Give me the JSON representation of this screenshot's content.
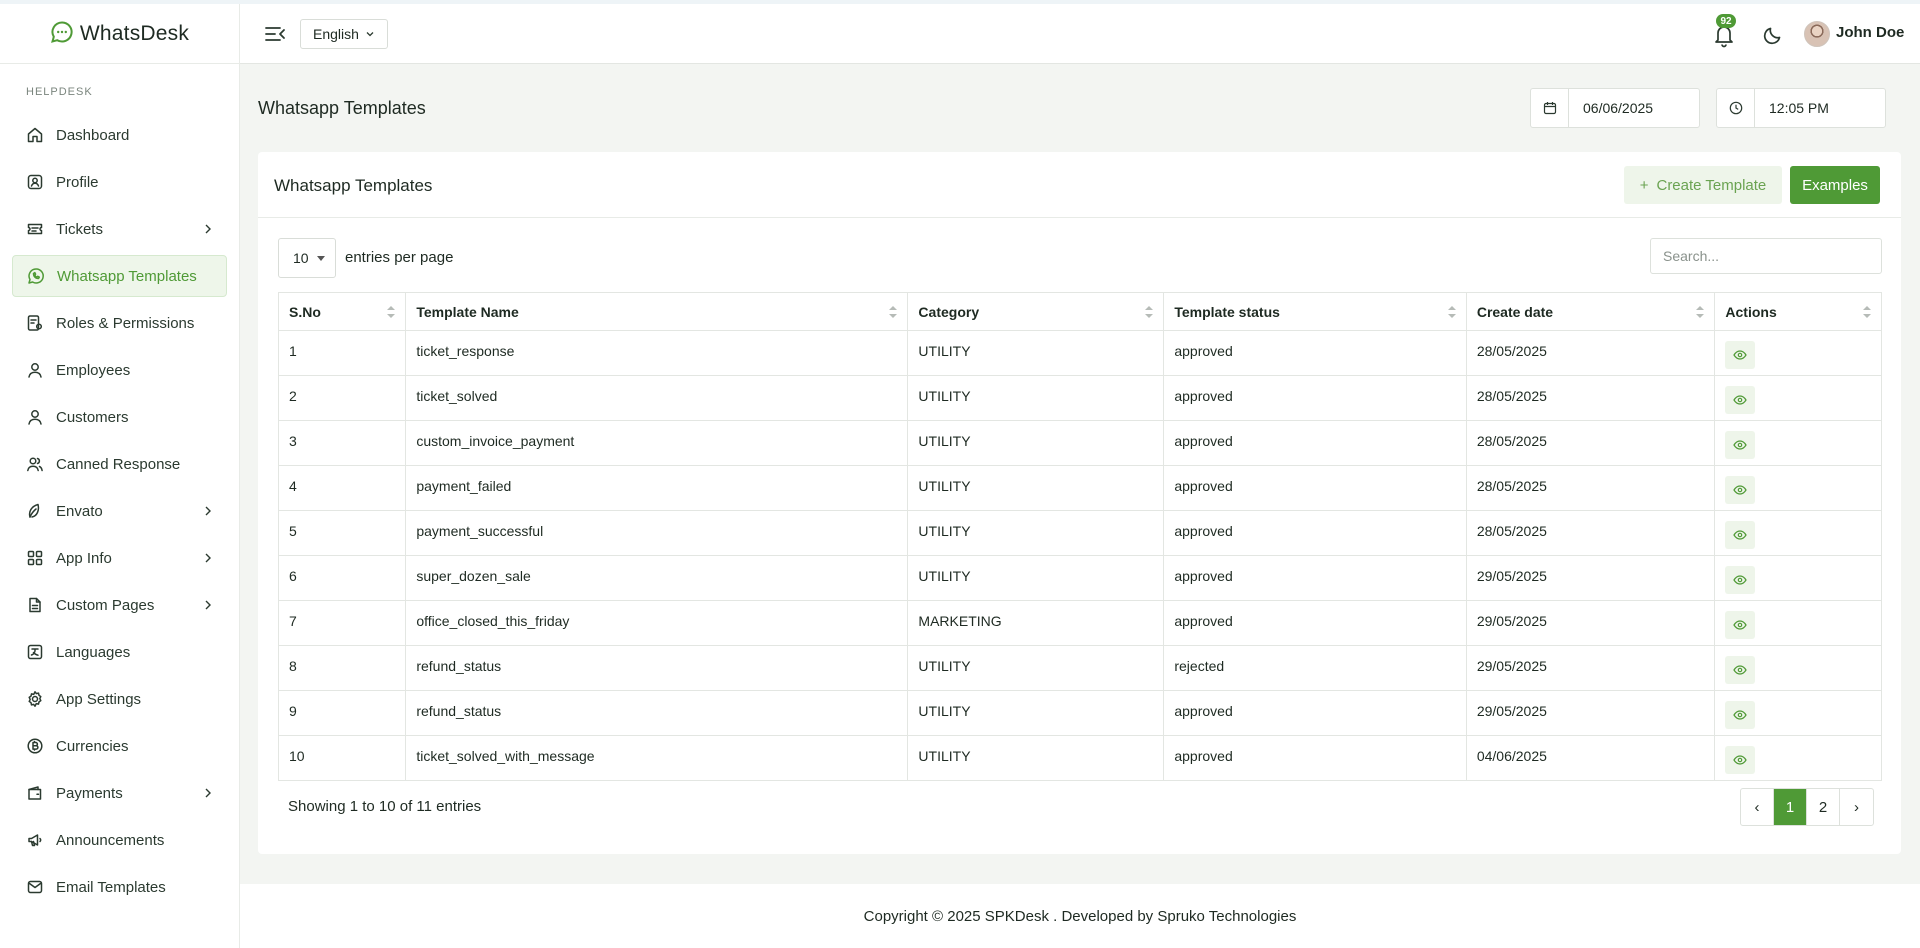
{
  "brand": {
    "name": "WhatsDesk"
  },
  "sidebar": {
    "section": "HELPDESK",
    "items": [
      {
        "label": "Dashboard",
        "icon": "home-icon",
        "has_children": false,
        "active": false
      },
      {
        "label": "Profile",
        "icon": "profile-icon",
        "has_children": false,
        "active": false
      },
      {
        "label": "Tickets",
        "icon": "ticket-icon",
        "has_children": true,
        "active": false
      },
      {
        "label": "Whatsapp Templates",
        "icon": "whatsapp-icon",
        "has_children": false,
        "active": true
      },
      {
        "label": "Roles & Permissions",
        "icon": "roles-icon",
        "has_children": false,
        "active": false
      },
      {
        "label": "Employees",
        "icon": "user-icon",
        "has_children": false,
        "active": false
      },
      {
        "label": "Customers",
        "icon": "user-icon",
        "has_children": false,
        "active": false
      },
      {
        "label": "Canned Response",
        "icon": "users-icon",
        "has_children": false,
        "active": false
      },
      {
        "label": "Envato",
        "icon": "leaf-icon",
        "has_children": true,
        "active": false
      },
      {
        "label": "App Info",
        "icon": "apps-icon",
        "has_children": true,
        "active": false
      },
      {
        "label": "Custom Pages",
        "icon": "file-icon",
        "has_children": true,
        "active": false
      },
      {
        "label": "Languages",
        "icon": "language-icon",
        "has_children": false,
        "active": false
      },
      {
        "label": "App Settings",
        "icon": "gear-icon",
        "has_children": false,
        "active": false
      },
      {
        "label": "Currencies",
        "icon": "currency-icon",
        "has_children": false,
        "active": false
      },
      {
        "label": "Payments",
        "icon": "wallet-icon",
        "has_children": true,
        "active": false
      },
      {
        "label": "Announcements",
        "icon": "megaphone-icon",
        "has_children": false,
        "active": false
      },
      {
        "label": "Email Templates",
        "icon": "mail-icon",
        "has_children": false,
        "active": false
      }
    ]
  },
  "header": {
    "language": "English",
    "notification_count": "92",
    "user_name": "John Doe"
  },
  "page": {
    "title": "Whatsapp Templates",
    "date": "06/06/2025",
    "time": "12:05 PM"
  },
  "card": {
    "title": "Whatsapp Templates",
    "create_label": "Create Template",
    "examples_label": "Examples",
    "entries_value": "10",
    "entries_label": "entries per page",
    "search_placeholder": "Search...",
    "showing_text": "Showing 1 to 10 of 11 entries"
  },
  "table": {
    "columns": [
      "S.No",
      "Template Name",
      "Category",
      "Template status",
      "Create date",
      "Actions"
    ],
    "rows": [
      [
        "1",
        "ticket_response",
        "UTILITY",
        "approved",
        "28/05/2025"
      ],
      [
        "2",
        "ticket_solved",
        "UTILITY",
        "approved",
        "28/05/2025"
      ],
      [
        "3",
        "custom_invoice_payment",
        "UTILITY",
        "approved",
        "28/05/2025"
      ],
      [
        "4",
        "payment_failed",
        "UTILITY",
        "approved",
        "28/05/2025"
      ],
      [
        "5",
        "payment_successful",
        "UTILITY",
        "approved",
        "28/05/2025"
      ],
      [
        "6",
        "super_dozen_sale",
        "UTILITY",
        "approved",
        "29/05/2025"
      ],
      [
        "7",
        "office_closed_this_friday",
        "MARKETING",
        "approved",
        "29/05/2025"
      ],
      [
        "8",
        "refund_status",
        "UTILITY",
        "rejected",
        "29/05/2025"
      ],
      [
        "9",
        "refund_status",
        "UTILITY",
        "approved",
        "29/05/2025"
      ],
      [
        "10",
        "ticket_solved_with_message",
        "UTILITY",
        "approved",
        "04/06/2025"
      ]
    ]
  },
  "pagination": {
    "prev": "‹",
    "pages": [
      "1",
      "2"
    ],
    "current": "1",
    "next": "›"
  },
  "footer": {
    "text": "Copyright © 2025 SPKDesk . Developed by Spruko Technologies"
  },
  "colors": {
    "accent": "#4f9a36",
    "accent_light": "#eef5ea",
    "background": "#f3f5f2"
  }
}
